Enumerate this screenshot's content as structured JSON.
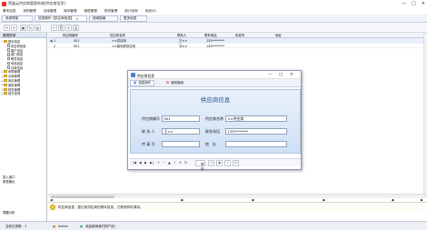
{
  "window": {
    "title": "黑盒云供应商管理系统[供应商信息]",
    "minimize_glyph": "—",
    "maximize_glyph": "□",
    "close_glyph": "✕"
  },
  "menubar": [
    "基本信息",
    "采购管理",
    "仓库管理",
    "库存管理",
    "销售管理",
    "财务管理",
    "统计查询",
    "系统(S)"
  ],
  "tabs": [
    {
      "label": "系统导航",
      "active": false,
      "closable": false
    },
    {
      "label": "信息操作【供应商信息】",
      "active": true,
      "closable": true
    },
    {
      "label": "使用指南",
      "active": false,
      "closable": false
    },
    {
      "label": "更多信息",
      "active": false,
      "closable": false
    }
  ],
  "toolbar_icons": [
    "edit-icon",
    "dropdown-icon",
    "new-icon",
    "refresh-icon",
    "save-icon",
    "cut-icon",
    "copy-icon",
    "delete-icon",
    "print-icon"
  ],
  "toolbar_glyphs": [
    "✎",
    "▾",
    "▣",
    "↻",
    "▤",
    "✂",
    "⎘",
    "✕",
    "⎙"
  ],
  "sidebar": {
    "header": "管理菜单",
    "tree": [
      {
        "label": "基本信息",
        "level": 0,
        "kind": "folder",
        "expanded": true
      },
      {
        "label": "供应商信息",
        "level": 1,
        "kind": "doc"
      },
      {
        "label": "客户信息",
        "level": 1,
        "kind": "doc"
      },
      {
        "label": "部门信息",
        "level": 1,
        "kind": "doc"
      },
      {
        "label": "职员信息",
        "level": 1,
        "kind": "doc"
      },
      {
        "label": "商品信息",
        "level": 1,
        "kind": "doc"
      },
      {
        "label": "仓库信息",
        "level": 1,
        "kind": "doc"
      },
      {
        "label": "采购管理",
        "level": 0,
        "kind": "folder",
        "expanded": false
      },
      {
        "label": "仓库管理",
        "level": 0,
        "kind": "folder",
        "expanded": false
      },
      {
        "label": "库存管理",
        "level": 0,
        "kind": "folder",
        "expanded": false
      },
      {
        "label": "销售管理",
        "level": 0,
        "kind": "folder",
        "expanded": false
      },
      {
        "label": "财务管理",
        "level": 0,
        "kind": "folder",
        "expanded": false
      },
      {
        "label": "统计查询",
        "level": 0,
        "kind": "folder",
        "expanded": false
      }
    ],
    "bottom_items": [
      "录入窗口",
      "报表输出"
    ],
    "footer": "提醒分析"
  },
  "grid": {
    "columns": [
      "供应商编号",
      "供应商名称",
      "联系人",
      "联系电话",
      "传真号",
      "地址"
    ],
    "rows": [
      {
        "indicator": "▶",
        "cells": [
          "001",
          "××供应商",
          "王××",
          "135********",
          "",
          ""
        ]
      },
      {
        "indicator": "",
        "cells": [
          "002",
          "××康利药供应商",
          "刘××",
          "139********",
          "",
          ""
        ]
      }
    ],
    "row_numbers": [
      "1",
      "2"
    ]
  },
  "bottom_marks": [
    "◀",
    "◆",
    "◆",
    "◆",
    "◆",
    "▶"
  ],
  "hint_text": "供应商信息，登记录供应商的基本信息，方便采购时调用。",
  "statusbar": {
    "left": "当前记录数：1",
    "user": "Admin",
    "welcome": "欢迎使用我们的产品！"
  },
  "dialog": {
    "title": "供应商信息",
    "tabs": [
      "信息操作",
      "使用指南"
    ],
    "form_title": "供应商信息",
    "fields": {
      "code_label": "供应商编号",
      "code_value": "001",
      "name_label": "供应商名称",
      "name_value": "××供应商",
      "contact_label": "联 系 人",
      "contact_value": "王××",
      "phone_label": "联系电话",
      "phone_value": "135********",
      "fax_label": "传 真 号",
      "fax_value": "",
      "address_label": "地　址",
      "address_value": ""
    },
    "nav_glyphs": [
      "|◀",
      "◀",
      "▶",
      "▶|",
      "+",
      "−",
      "▲",
      "✓",
      "✕",
      "↻"
    ],
    "tool_icons": [
      "help-icon",
      "print-icon",
      "preview-icon",
      "export-icon",
      "exit-icon"
    ],
    "tool_labels": [
      "帮助",
      "打印",
      "预览",
      "导出",
      "退出"
    ],
    "tool_glyphs": [
      "?",
      "⎙",
      "◉",
      "⇪",
      "⏻"
    ]
  }
}
